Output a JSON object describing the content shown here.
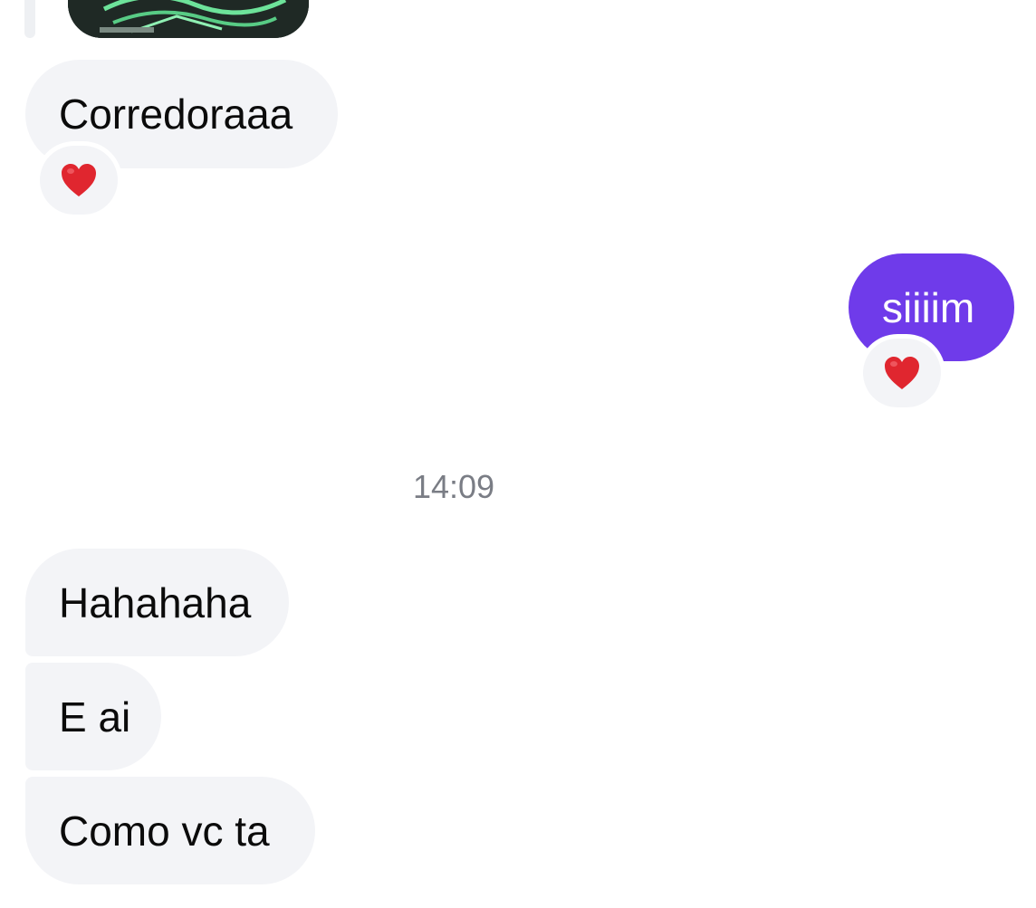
{
  "thread": {
    "messages": [
      {
        "id": "m1",
        "direction": "incoming",
        "text": "Corredoraaa",
        "reaction": "heart"
      },
      {
        "id": "m2",
        "direction": "outgoing",
        "text": "siiiim",
        "reaction": "heart"
      },
      {
        "id": "m3",
        "direction": "incoming",
        "text": "Hahahaha"
      },
      {
        "id": "m4",
        "direction": "incoming",
        "text": "E ai"
      },
      {
        "id": "m5",
        "direction": "incoming",
        "text": "Como vc ta"
      }
    ],
    "timestamp": "14:09"
  },
  "colors": {
    "incoming_bubble": "#f3f4f7",
    "outgoing_bubble": "#6f3bea",
    "reaction_heart": "#e0262f"
  }
}
